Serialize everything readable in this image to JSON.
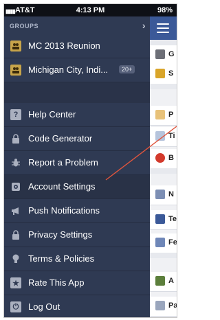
{
  "status_bar": {
    "carrier": "AT&T",
    "time": "4:13 PM",
    "battery": "98%"
  },
  "groups": {
    "header": "GROUPS",
    "items": [
      {
        "label": "MC 2013 Reunion"
      },
      {
        "label": "Michigan City, Indi...",
        "badge": "20+"
      }
    ]
  },
  "menu": {
    "items": [
      {
        "label": "Help Center",
        "icon": "help-icon"
      },
      {
        "label": "Code Generator",
        "icon": "lock-icon"
      },
      {
        "label": "Report a Problem",
        "icon": "bug-icon"
      },
      {
        "label": "Account Settings",
        "icon": "gear-icon"
      },
      {
        "label": "Push Notifications",
        "icon": "megaphone-icon"
      },
      {
        "label": "Privacy Settings",
        "icon": "lock-icon"
      },
      {
        "label": "Terms & Policies",
        "icon": "lightbulb-icon"
      },
      {
        "label": "Rate This App",
        "icon": "star-icon"
      },
      {
        "label": "Log Out",
        "icon": "power-icon"
      }
    ]
  },
  "content_preview": {
    "letters": [
      "G",
      "S",
      "P",
      "Ti",
      "B",
      "N",
      "Te",
      "Fe",
      "A",
      "Pa"
    ]
  },
  "colors": {
    "menu_bg": "#2f3a53",
    "header_bar": "#3b5998",
    "annotation_arrow": "#e0553d"
  }
}
